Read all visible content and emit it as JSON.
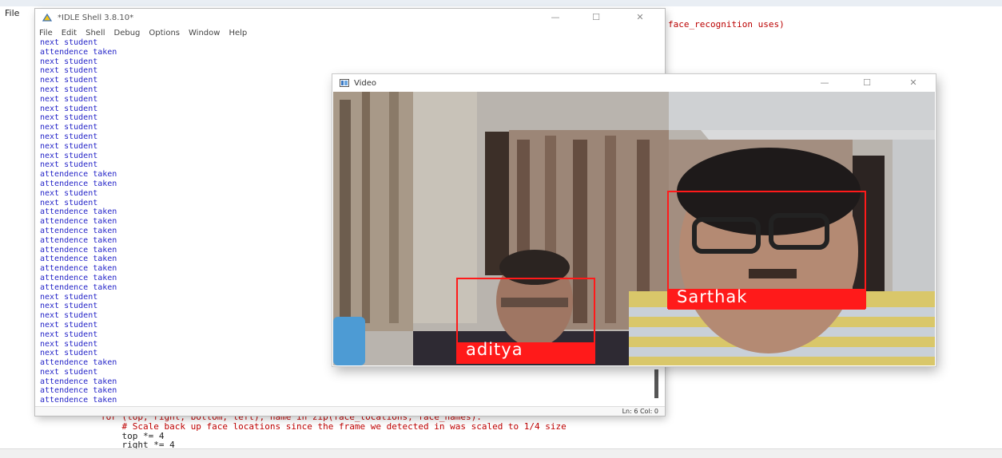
{
  "background_editor": {
    "menu_label": "File",
    "code_lines": [
      "face_recognition uses)",
      "for (top, right, bottom, left), name in zip(face_locations, face_names):",
      "    # Scale back up face locations since the frame we detected in was scaled to 1/4 size",
      "    top *= 4",
      "    right *= 4"
    ]
  },
  "idle_shell": {
    "title": "*IDLE Shell 3.8.10*",
    "menu": [
      "File",
      "Edit",
      "Shell",
      "Debug",
      "Options",
      "Window",
      "Help"
    ],
    "output_lines": [
      "next student",
      "attendence taken",
      "next student",
      "next student",
      "next student",
      "next student",
      "next student",
      "next student",
      "next student",
      "next student",
      "next student",
      "next student",
      "next student",
      "next student",
      "attendence taken",
      "attendence taken",
      "next student",
      "next student",
      "attendence taken",
      "attendence taken",
      "attendence taken",
      "attendence taken",
      "attendence taken",
      "attendence taken",
      "attendence taken",
      "attendence taken",
      "attendence taken",
      "next student",
      "next student",
      "next student",
      "next student",
      "next student",
      "next student",
      "next student",
      "attendence taken",
      "next student",
      "attendence taken",
      "attendence taken",
      "attendence taken"
    ],
    "status": "Ln: 6   Col: 0"
  },
  "video_window": {
    "title": "Video",
    "faces": [
      {
        "name": "aditya"
      },
      {
        "name": "Sarthak"
      }
    ],
    "box_color": "#ff1a1a"
  },
  "window_controls": {
    "minimize": "—",
    "maximize": "☐",
    "close": "✕"
  }
}
